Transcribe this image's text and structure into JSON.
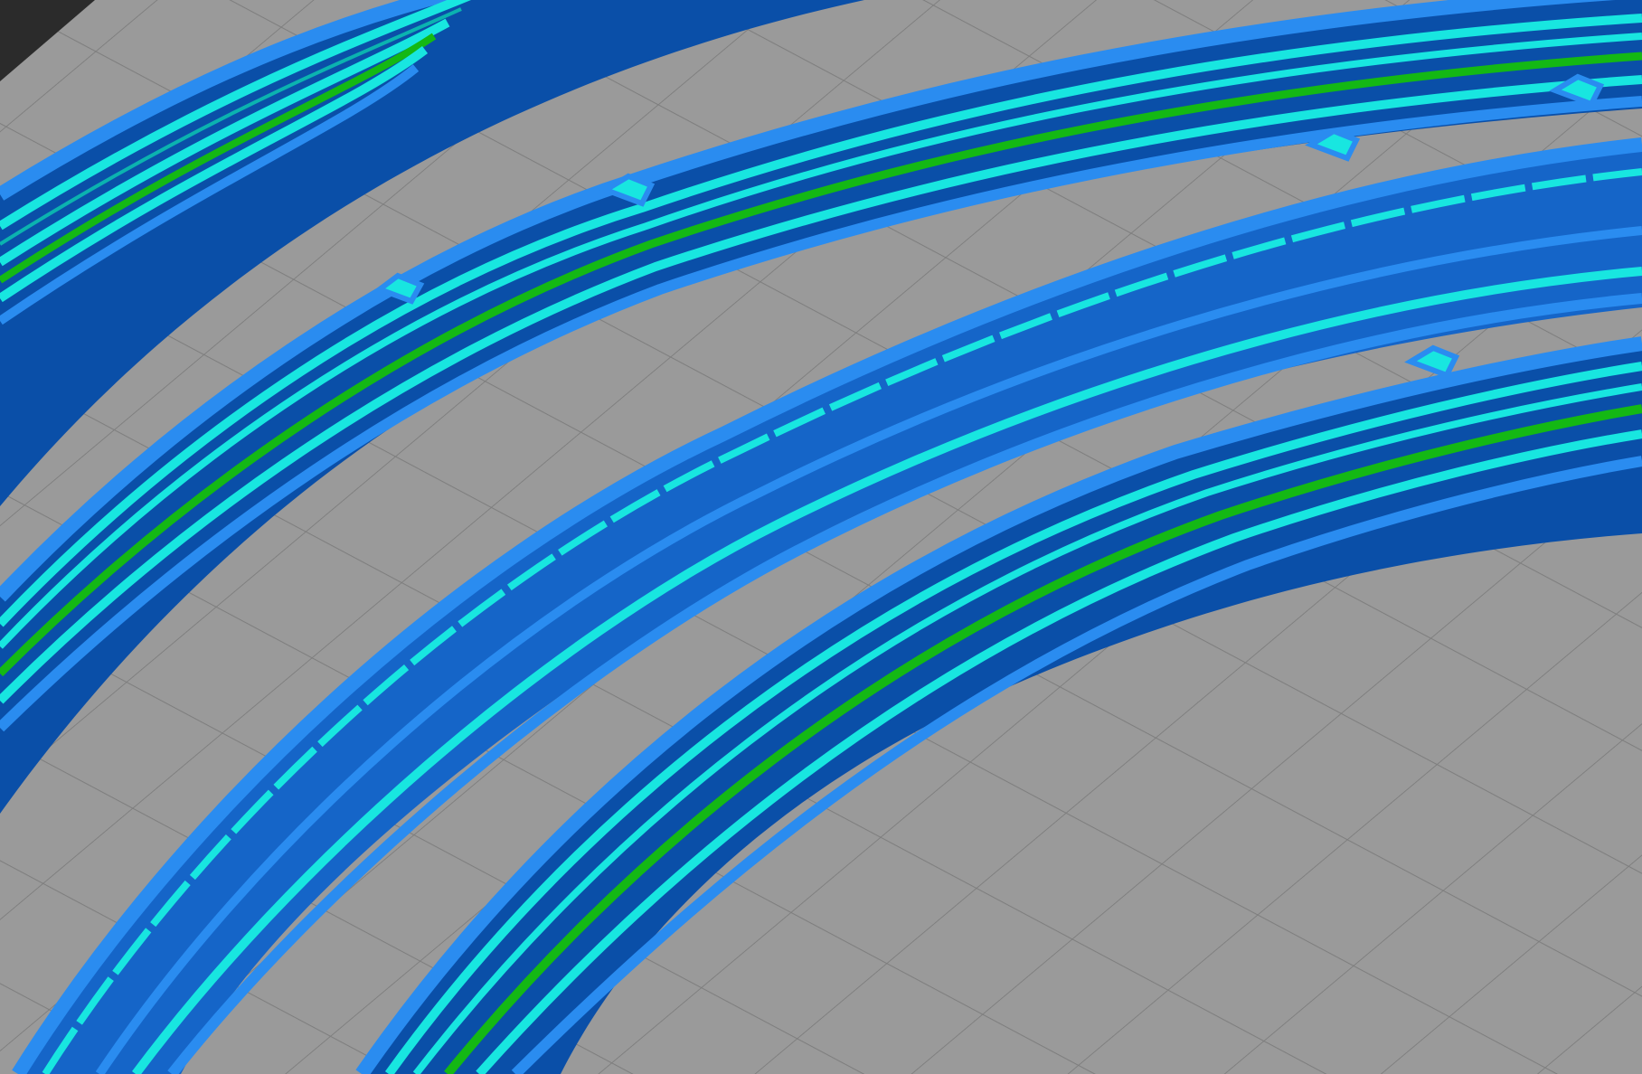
{
  "app": {
    "view": "slicer-gcode-preview"
  },
  "colors": {
    "bed": "#9a9a9a",
    "bed_grid_line": "#7e7e7e",
    "bed_edge_shadow": "#2b2b2b",
    "wall_dark": "#0a4fa8",
    "wall_mid": "#1565c8",
    "wall_edge": "#2a8cf0",
    "perimeter_cyan": "#18e6e0",
    "perimeter_cyan_dark": "#0bb3b0",
    "fill_green": "#14b814",
    "fill_green_dark": "#0a8a0a"
  },
  "scene": {
    "bands": [
      {
        "name": "band-1",
        "has_green_line": true
      },
      {
        "name": "band-2",
        "has_green_line": true
      },
      {
        "name": "band-3",
        "has_green_line": false
      },
      {
        "name": "band-4",
        "has_green_line": true
      }
    ]
  }
}
